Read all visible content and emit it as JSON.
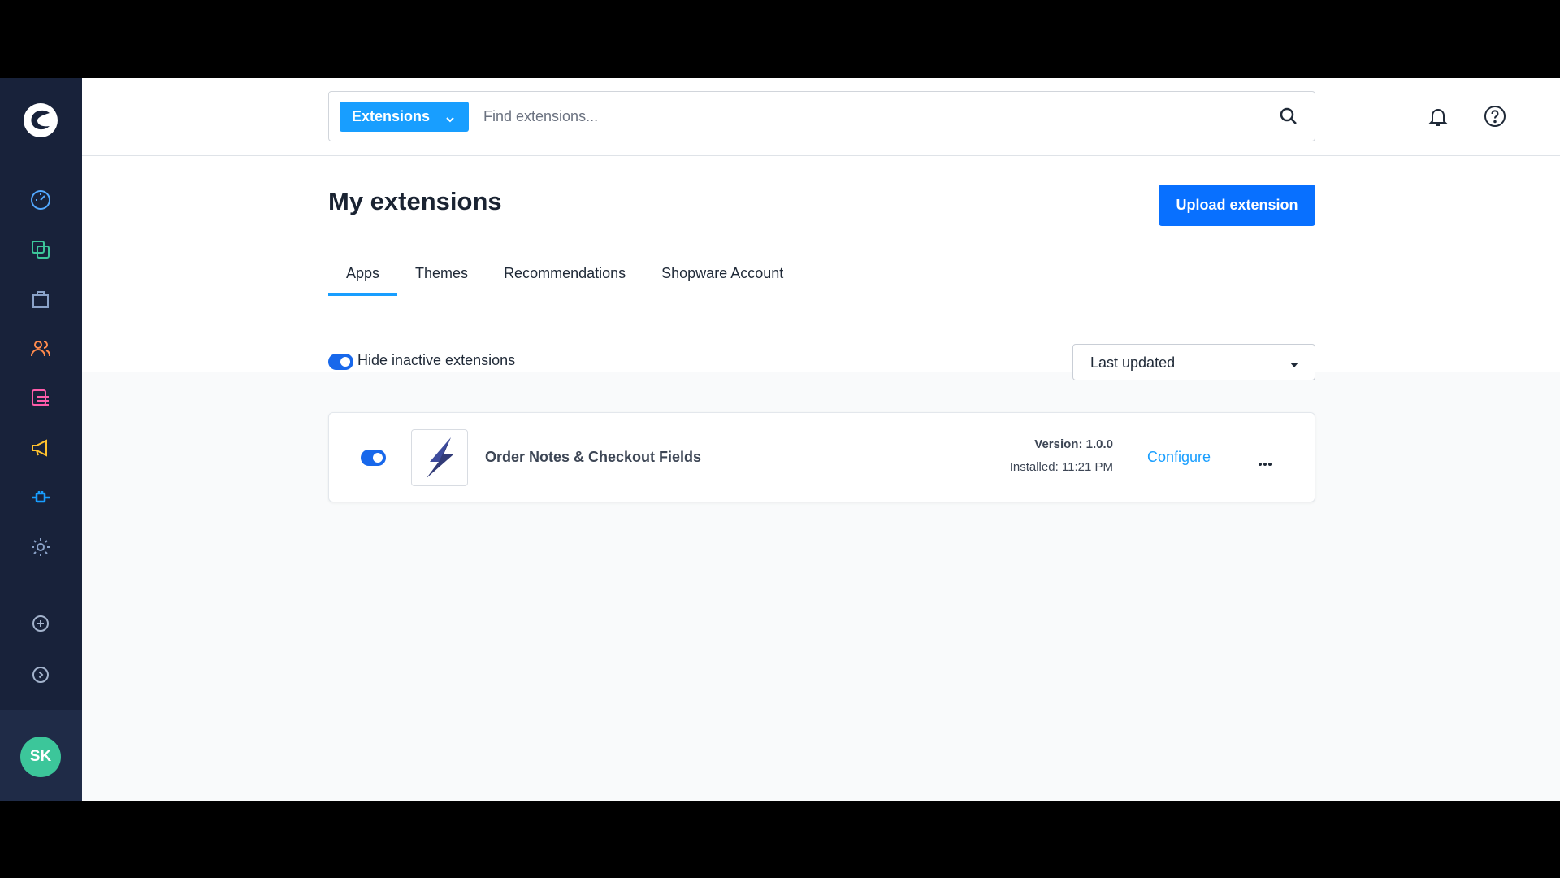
{
  "colors": {
    "sidebar": "#18223a",
    "primary": "#189eff",
    "button": "#0870ff",
    "avatar": "#3cc69a"
  },
  "sidebar": {
    "logo_icon": "shopware-logo-icon",
    "items": [
      {
        "name": "dashboard",
        "icon": "gauge-icon"
      },
      {
        "name": "catalogues",
        "icon": "copy-icon"
      },
      {
        "name": "orders",
        "icon": "shopping-bag-icon"
      },
      {
        "name": "customers",
        "icon": "users-icon"
      },
      {
        "name": "content",
        "icon": "content-list-icon"
      },
      {
        "name": "marketing",
        "icon": "megaphone-icon"
      },
      {
        "name": "extensions",
        "icon": "plug-icon"
      },
      {
        "name": "settings",
        "icon": "gear-icon"
      },
      {
        "name": "add",
        "icon": "plus-circle-icon"
      },
      {
        "name": "expand",
        "icon": "chevron-right-circle-icon"
      }
    ],
    "avatar_initials": "SK"
  },
  "header": {
    "search_type": "Extensions",
    "search_placeholder": "Find extensions..."
  },
  "page": {
    "title": "My extensions",
    "upload_label": "Upload extension",
    "tabs": [
      {
        "label": "Apps",
        "active": true
      },
      {
        "label": "Themes",
        "active": false
      },
      {
        "label": "Recommendations",
        "active": false
      },
      {
        "label": "Shopware Account",
        "active": false
      }
    ]
  },
  "filters": {
    "hide_inactive_label": "Hide inactive extensions",
    "hide_inactive_on": true,
    "sort_selected": "Last updated"
  },
  "extensions": [
    {
      "name": "Order Notes & Checkout Fields",
      "active": true,
      "version": "Version: 1.0.0",
      "installed": "Installed: 11:21 PM",
      "configure_label": "Configure",
      "logo_icon": "lightning-bolt-icon"
    }
  ]
}
